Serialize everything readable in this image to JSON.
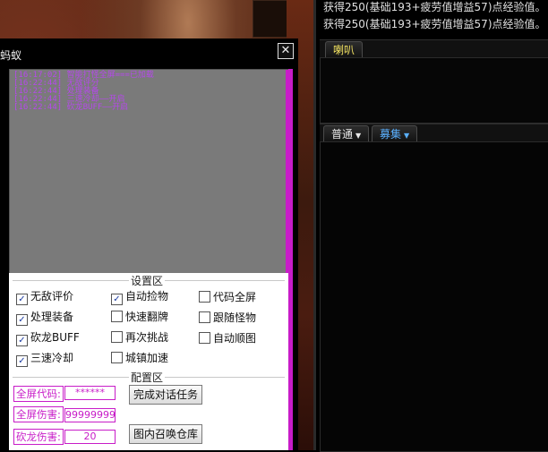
{
  "window": {
    "title": "蚂蚁",
    "close_glyph": "✕"
  },
  "log_lines": [
    "[16:17:02] 智能打怪全屏===已加载",
    "[16:22:44] 无敌评分",
    "[16:22:44] 处理装备",
    "[16:22:44] 三速冷却——开启",
    "[16:22:44] 砍龙BUFF——开启"
  ],
  "settings": {
    "title": "设置区",
    "checkboxes": [
      {
        "label": "无敌评价",
        "checked": true
      },
      {
        "label": "处理装备",
        "checked": true
      },
      {
        "label": "砍龙BUFF",
        "checked": true
      },
      {
        "label": "三速冷却",
        "checked": true
      },
      {
        "label": "自动捡物",
        "checked": true
      },
      {
        "label": "快速翻牌",
        "checked": false
      },
      {
        "label": "再次挑战",
        "checked": false
      },
      {
        "label": "城镇加速",
        "checked": false
      },
      {
        "label": "代码全屏",
        "checked": false
      },
      {
        "label": "跟随怪物",
        "checked": false
      },
      {
        "label": "自动顺图",
        "checked": false
      }
    ]
  },
  "config": {
    "title": "配置区",
    "fields": [
      {
        "label": "全屏代码:",
        "value": "******"
      },
      {
        "label": "全屏伤害:",
        "value": "99999999"
      },
      {
        "label": "砍龙伤害:",
        "value": "20"
      }
    ],
    "buttons": [
      {
        "label": "完成对话任务"
      },
      {
        "label": "图内召唤仓库"
      }
    ]
  },
  "chat": {
    "system_messages": [
      "获得250(基础193+疲劳值增益57)点经验值。",
      "获得250(基础193+疲劳值增益57)点经验值。"
    ],
    "top_tab": "喇叭",
    "tabs": [
      {
        "label": "普通"
      },
      {
        "label": "募集"
      }
    ]
  },
  "icons": {
    "check": "check-icon",
    "caret": "caret-down-icon",
    "close": "close-icon"
  },
  "colors": {
    "accent_magenta": "#c81cc8",
    "recruit_blue": "#5ab0ff"
  }
}
